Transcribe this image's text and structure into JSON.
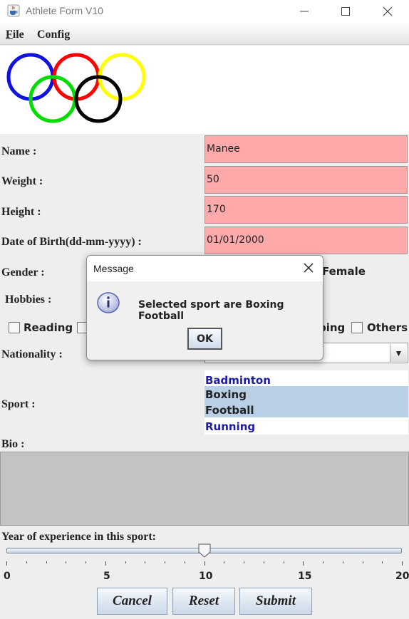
{
  "window": {
    "title": "Athlete Form V10",
    "icons": {
      "app": "java-cup-icon",
      "minimize": "minimize-icon",
      "maximize": "maximize-icon",
      "close": "close-icon"
    }
  },
  "menu": {
    "file_accel": "F",
    "file_rest": "ile",
    "config": "Config"
  },
  "logo": {
    "ring_colors": [
      "#1010e0",
      "#ff0000",
      "#ffff00",
      "#00dd00",
      "#000000"
    ]
  },
  "form": {
    "name": {
      "label": "Name :",
      "value": "Manee"
    },
    "weight": {
      "label": "Weight :",
      "value": "50"
    },
    "height": {
      "label": "Height :",
      "value": "170"
    },
    "dob": {
      "label": "Date of Birth(dd-mm-yyyy) :",
      "value": "01/01/2000"
    },
    "field_color": "#ffaaaa",
    "gender": {
      "label": "Gender :",
      "female_label": "Female"
    },
    "hobbies": {
      "label": "Hobbies :",
      "reading": "Reading",
      "partial": "ping",
      "others": "Others"
    },
    "nationality": {
      "label": "Nationality :"
    },
    "sport": {
      "label": "Sport :",
      "items": [
        "Badminton",
        "Boxing",
        "Football",
        "Running"
      ],
      "selected": [
        "Boxing",
        "Football"
      ]
    },
    "bio": {
      "label": "Bio :"
    },
    "experience": {
      "label": "Year of experience in this sport:",
      "min": 0,
      "max": 20,
      "value": 10,
      "ticks": [
        "0",
        "5",
        "10",
        "15",
        "20"
      ]
    },
    "buttons": {
      "cancel": "Cancel",
      "reset": "Reset",
      "submit": "Submit"
    }
  },
  "dialog": {
    "title": "Message",
    "message": "Selected sport are Boxing Football",
    "ok": "OK",
    "icon": "info-icon"
  }
}
